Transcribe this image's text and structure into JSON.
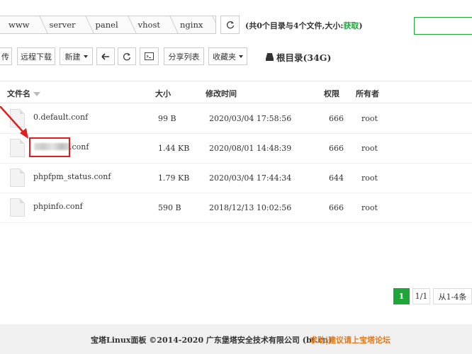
{
  "breadcrumb": [
    "www",
    "server",
    "panel",
    "vhost",
    "nginx"
  ],
  "dir_info": {
    "text": "(共0个目录与4个文件,大小:",
    "get_label": "获取",
    "close": ")"
  },
  "toolbar": {
    "upload_partial": "传",
    "remote_download": "远程下载",
    "new_label": "新建",
    "share_list": "分享列表",
    "favorites": "收藏夹",
    "root_dir": "根目录(34G)"
  },
  "table": {
    "headers": {
      "name": "文件名",
      "size": "大小",
      "mtime": "修改时间",
      "perm": "权限",
      "owner": "所有者"
    },
    "rows": [
      {
        "name": "0.default.conf",
        "size": "99 B",
        "mtime": "2020/03/04 17:58:56",
        "perm": "666",
        "owner": "root"
      },
      {
        "name": ".conf",
        "size": "1.44 KB",
        "mtime": "2020/08/01 14:48:39",
        "perm": "666",
        "owner": "root"
      },
      {
        "name": "phpfpm_status.conf",
        "size": "1.79 KB",
        "mtime": "2020/03/04 17:44:34",
        "perm": "644",
        "owner": "root"
      },
      {
        "name": "phpinfo.conf",
        "size": "590 B",
        "mtime": "2018/12/13 10:02:56",
        "perm": "666",
        "owner": "root"
      }
    ]
  },
  "pagination": {
    "current": "1",
    "pages": "1/1",
    "range": "从1-4条"
  },
  "footer": {
    "copyright": "宝塔Linux面板 ©2014-2020 广东堡塔安全技术有限公司 (bt.cn)",
    "help": "求助|建议请上宝塔论坛"
  },
  "colors": {
    "accent": "#20a53a",
    "highlight": "#e02020",
    "link": "#e07a1f"
  }
}
